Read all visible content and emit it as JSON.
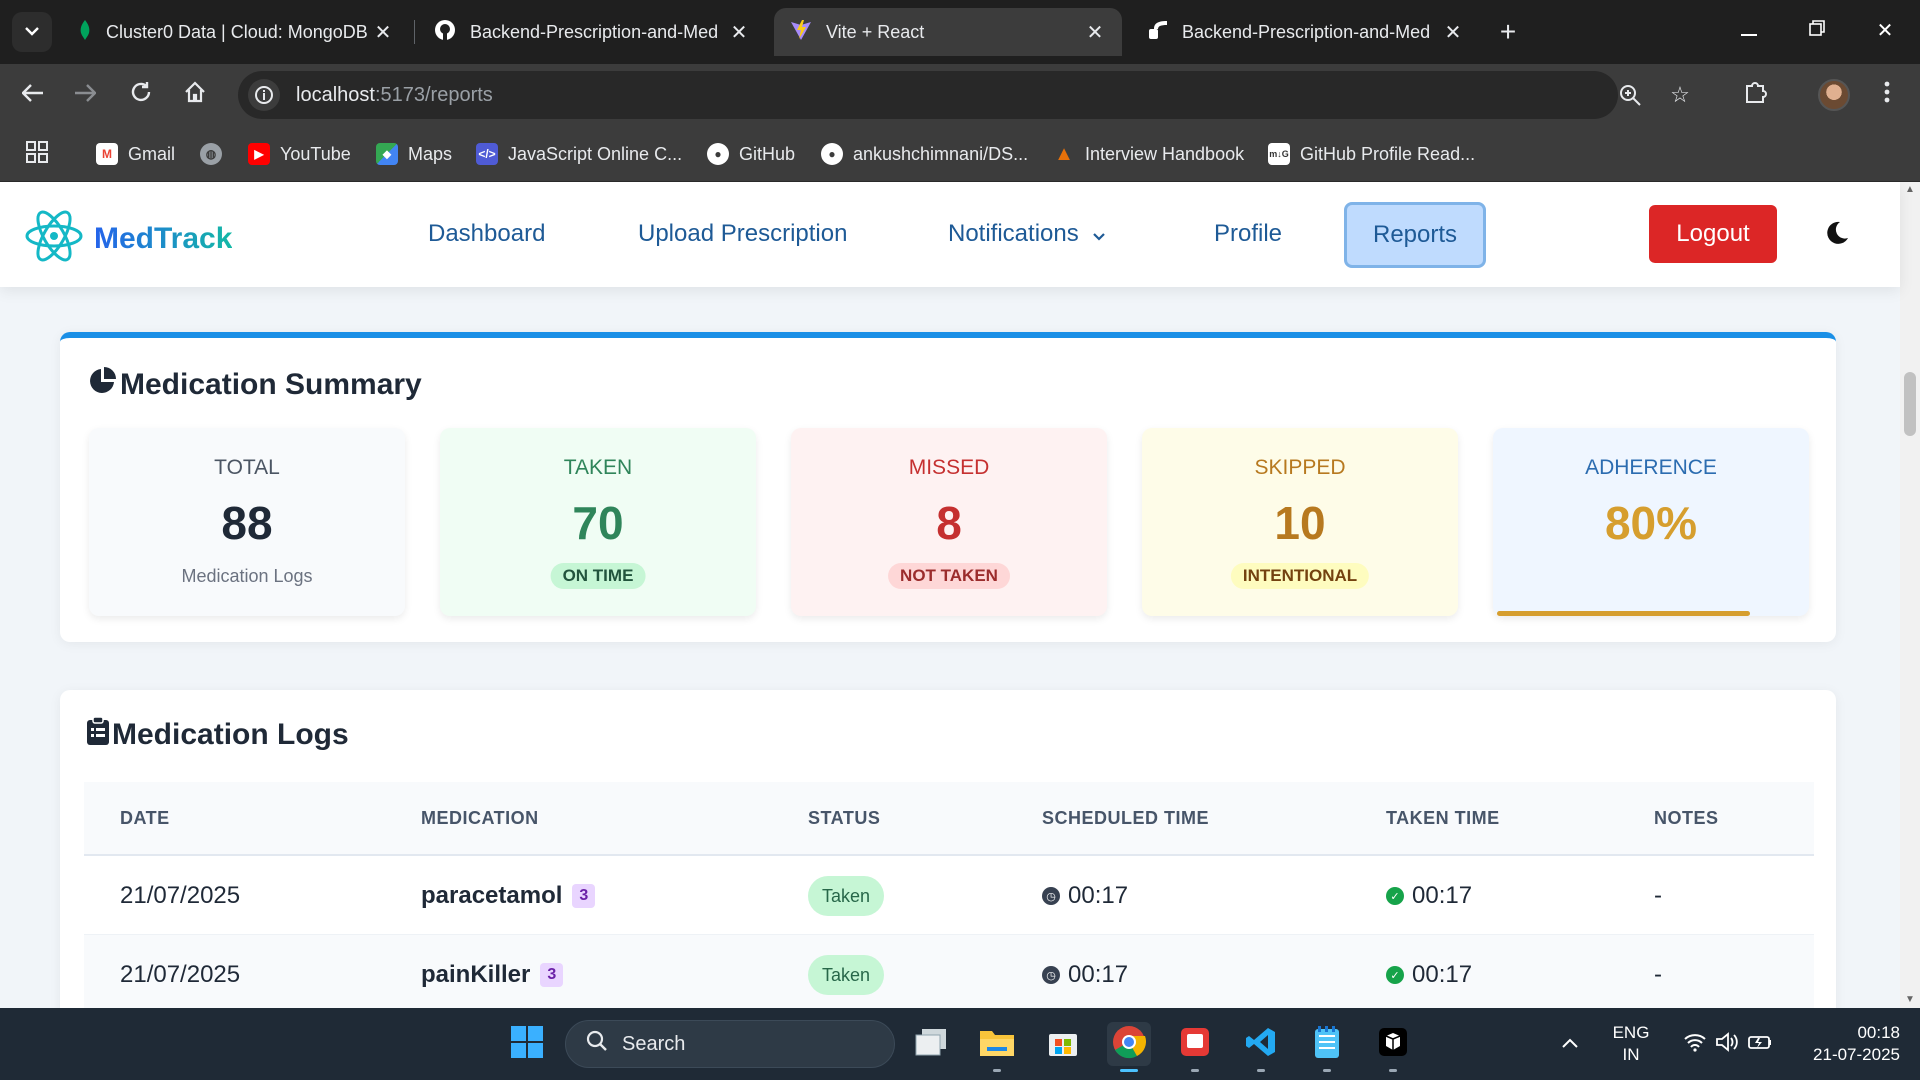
{
  "browser": {
    "tabs": [
      {
        "title": "Cluster0 Data | Cloud: MongoDB",
        "active": false,
        "favicon": "mongodb-leaf-icon"
      },
      {
        "title": "Backend-Prescription-and-Med",
        "active": false,
        "favicon": "github-icon"
      },
      {
        "title": "Vite + React",
        "active": true,
        "favicon": "vite-icon"
      },
      {
        "title": "Backend-Prescription-and-Med",
        "active": false,
        "favicon": "render-icon"
      }
    ],
    "url_host": "localhost",
    "url_path": ":5173/reports",
    "bookmarks": [
      {
        "label": "Gmail",
        "icon": "gmail-icon",
        "color": "#ea4335"
      },
      {
        "label": "",
        "icon": "globe-icon",
        "color": "#9aa0a6"
      },
      {
        "label": "YouTube",
        "icon": "youtube-icon",
        "color": "#ff0000"
      },
      {
        "label": "Maps",
        "icon": "maps-icon",
        "color": "#34a853"
      },
      {
        "label": "JavaScript Online C...",
        "icon": "code-icon",
        "color": "#4f5bd5"
      },
      {
        "label": "GitHub",
        "icon": "github-icon",
        "color": "#ffffff"
      },
      {
        "label": "ankushchimnani/DS...",
        "icon": "github-icon",
        "color": "#ffffff"
      },
      {
        "label": "Interview Handbook",
        "icon": "handbook-icon",
        "color": "#e8710a"
      },
      {
        "label": "GitHub Profile Read...",
        "icon": "readme-icon",
        "color": "#ffffff"
      }
    ]
  },
  "app": {
    "brand": "MedTrack",
    "nav": {
      "dashboard": "Dashboard",
      "upload": "Upload Prescription",
      "notifications": "Notifications",
      "profile": "Profile",
      "reports": "Reports",
      "logout": "Logout"
    },
    "summary": {
      "title": "Medication Summary",
      "total": {
        "label": "TOTAL",
        "value": "88",
        "sub": "Medication Logs"
      },
      "taken": {
        "label": "TAKEN",
        "value": "70",
        "badge": "ON TIME"
      },
      "missed": {
        "label": "MISSED",
        "value": "8",
        "badge": "NOT TAKEN"
      },
      "skipped": {
        "label": "SKIPPED",
        "value": "10",
        "badge": "INTENTIONAL"
      },
      "adherence": {
        "label": "ADHERENCE",
        "value": "80%",
        "fraction": 0.8
      }
    },
    "logs": {
      "title": "Medication Logs",
      "columns": [
        "DATE",
        "MEDICATION",
        "STATUS",
        "SCHEDULED TIME",
        "TAKEN TIME",
        "NOTES"
      ],
      "rows": [
        {
          "date": "21/07/2025",
          "medication": "paracetamol",
          "count": "3",
          "status": "Taken",
          "scheduled": "00:17",
          "taken": "00:17",
          "notes": "-"
        },
        {
          "date": "21/07/2025",
          "medication": "painKiller",
          "count": "3",
          "status": "Taken",
          "scheduled": "00:17",
          "taken": "00:17",
          "notes": "-"
        }
      ]
    }
  },
  "taskbar": {
    "search_placeholder": "Search",
    "lang_line1": "ENG",
    "lang_line2": "IN",
    "time": "00:18",
    "date": "21-07-2025"
  },
  "colors": {
    "taken_green": "#2f855a",
    "missed_red": "#c53030",
    "skipped_amber": "#b7791f",
    "adherence_blue": "#2b6cb0",
    "logout_red": "#dc2626"
  }
}
